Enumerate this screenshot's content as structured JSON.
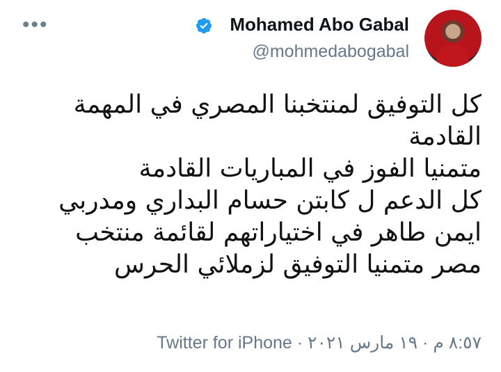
{
  "tweet": {
    "more_icon": "more-icon",
    "display_name": "Mohamed Abo Gabal",
    "handle": "@mohmedabogabal",
    "verified_icon": "verified-badge-icon",
    "lines": [
      "كل التوفيق لمنتخبنا المصري في المهمة",
      "القادمة",
      "متمنيا الفوز في المباريات القادمة",
      "كل الدعم ل كابتن حسام البداري ومدربي",
      "ايمن طاهر في اختياراتهم لقائمة منتخب",
      "مصر متمنيا التوفيق لزملائي الحرس"
    ],
    "meta": "٨:٥٧ م · ١٩ مارس ٢٠٢١ · Twitter for iPhone"
  }
}
